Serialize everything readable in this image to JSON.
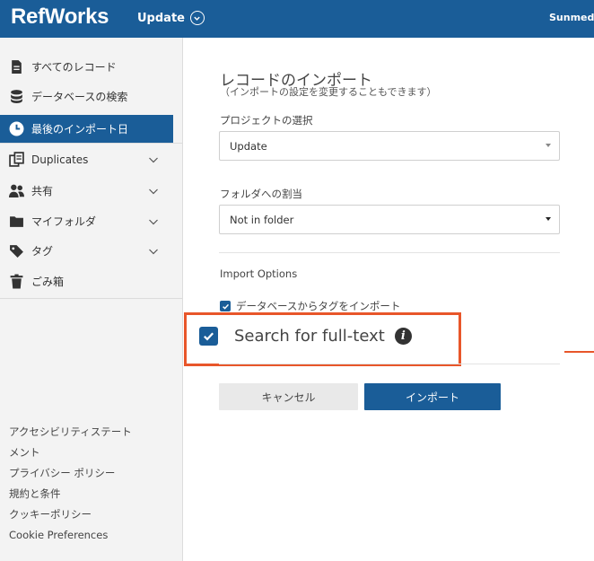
{
  "header": {
    "logo": "RefWorks",
    "project_name": "Update",
    "user_name": "Sunmedia"
  },
  "sidebar": {
    "items": [
      {
        "label": "すべてのレコード",
        "icon": "document-icon"
      },
      {
        "label": "データベースの検索",
        "icon": "database-icon"
      },
      {
        "label": "最後のインポート日",
        "icon": "clock-icon"
      },
      {
        "label": "Duplicates",
        "icon": "duplicates-icon"
      },
      {
        "label": "共有",
        "icon": "users-icon"
      },
      {
        "label": "マイフォルダ",
        "icon": "folder-icon"
      },
      {
        "label": "タグ",
        "icon": "tag-icon"
      },
      {
        "label": "ごみ箱",
        "icon": "trash-icon"
      }
    ],
    "footer": [
      "アクセシビリティステート",
      "メント",
      "プライバシー ポリシー",
      "規約と条件",
      "クッキーポリシー",
      "Cookie Preferences"
    ]
  },
  "main": {
    "title": "レコードのインポート",
    "subtitle": "（インポートの設定を変更することもできます）",
    "project_label": "プロジェクトの選択",
    "project_value": "Update",
    "folder_label": "フォルダへの割当",
    "folder_value": "Not in folder",
    "import_options_label": "Import Options",
    "import_tags_label": "データベースからタグをインポート",
    "full_text_label": "Search for full-text",
    "cancel_label": "キャンセル",
    "import_label": "インポート"
  },
  "colors": {
    "brand": "#1a5d98",
    "highlight": "#e8562a"
  }
}
